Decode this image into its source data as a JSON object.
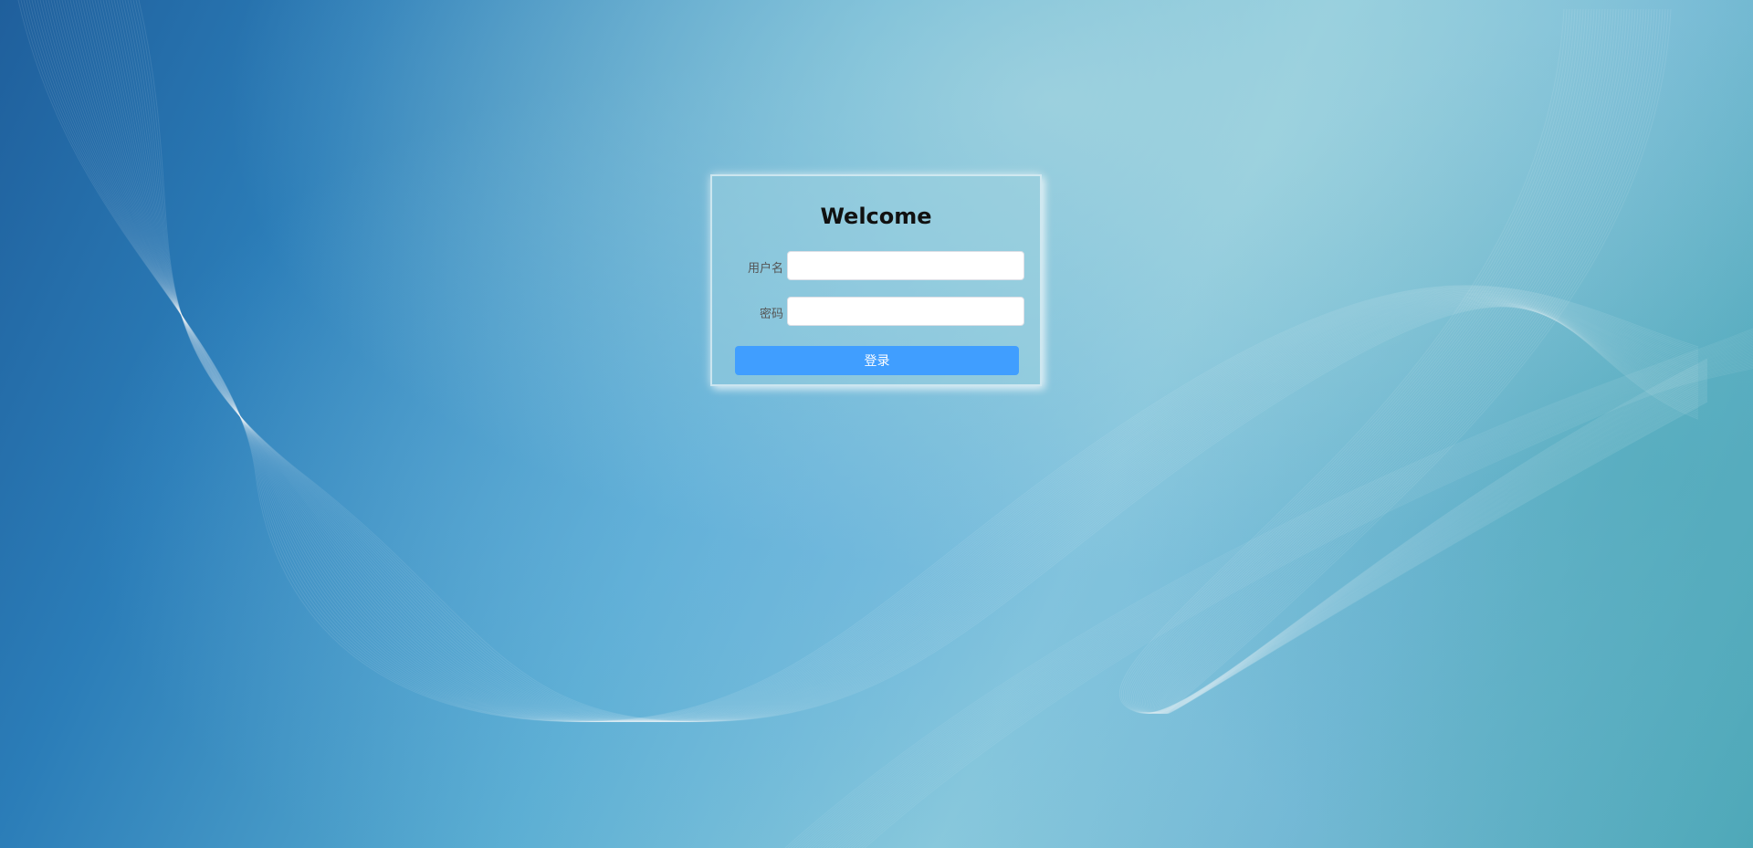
{
  "login": {
    "title": "Welcome",
    "username_label": "用户名",
    "username_value": "",
    "password_label": "密码",
    "password_value": "",
    "submit_label": "登录"
  },
  "colors": {
    "button": "#409eff",
    "background_start": "#1f5f9c",
    "background_end": "#4ea8b8"
  }
}
